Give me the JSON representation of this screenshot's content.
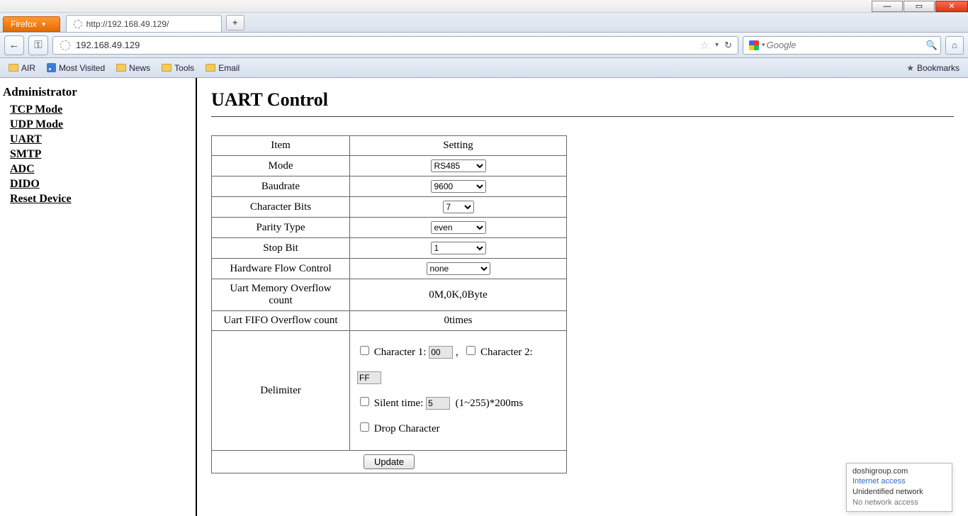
{
  "browser": {
    "app_button": "Firefox",
    "tab_title": "http://192.168.49.129/",
    "newtab_glyph": "+",
    "back_glyph": "←",
    "keyhole_glyph": "⚿",
    "url": "192.168.49.129",
    "star_glyph": "☆",
    "chev_glyph": "▾",
    "reload_glyph": "↻",
    "search_placeholder": "Google",
    "mag_glyph": "🔍",
    "home_glyph": "⌂"
  },
  "bookmarks": {
    "air": "AIR",
    "most_visited": "Most Visited",
    "news": "News",
    "tools": "Tools",
    "email": "Email",
    "right": "Bookmarks"
  },
  "nav": {
    "header": "Administrator",
    "items": [
      "TCP Mode",
      "UDP Mode",
      "UART",
      "SMTP",
      "ADC",
      "DIDO",
      "Reset Device"
    ]
  },
  "page": {
    "title": "UART Control",
    "th_item": "Item",
    "th_setting": "Setting",
    "rows": {
      "mode": {
        "label": "Mode",
        "value": "RS485"
      },
      "baud": {
        "label": "Baudrate",
        "value": "9600"
      },
      "cbits": {
        "label": "Character Bits",
        "value": "7"
      },
      "parity": {
        "label": "Parity Type",
        "value": "even"
      },
      "stop": {
        "label": "Stop Bit",
        "value": "1"
      },
      "hwflow": {
        "label": "Hardware Flow Control",
        "value": "none"
      },
      "memovf": {
        "label": "Uart Memory Overflow count",
        "value": "0M,0K,0Byte"
      },
      "fifoovf": {
        "label": "Uart FIFO Overflow count",
        "value": "0times"
      },
      "delim": {
        "label": "Delimiter"
      }
    },
    "delim": {
      "char1_label": "Character 1:",
      "char1_value": "00",
      "sep": ",",
      "char2_label": "Character 2:",
      "char2_value": "FF",
      "silent_label": "Silent time:",
      "silent_value": "5",
      "silent_suffix": "(1~255)*200ms",
      "drop_label": "Drop Character"
    },
    "update": "Update"
  },
  "netpopup": {
    "l1": "doshigroup.com",
    "l2": "Internet access",
    "l3": "Unidentified network",
    "l4": "No network access"
  }
}
